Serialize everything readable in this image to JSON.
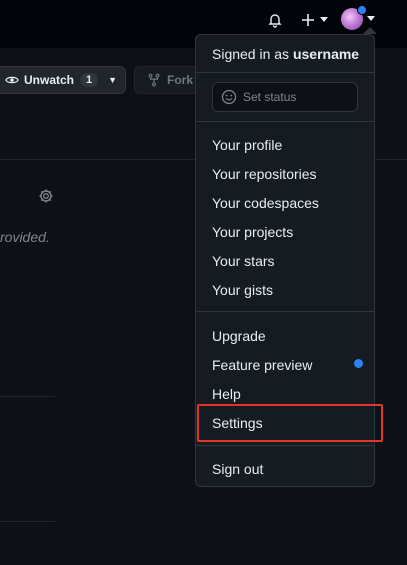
{
  "header": {
    "bell_icon": "bell-icon",
    "plus_icon": "plus-icon",
    "avatar": "user-avatar"
  },
  "repo_actions": {
    "unwatch_label": "Unwatch",
    "unwatch_count": "1",
    "fork_label": "Fork"
  },
  "main": {
    "description_fragment": "rovided."
  },
  "menu": {
    "signed_in_prefix": "Signed in as ",
    "username": "username",
    "set_status": "Set status",
    "items_group1": [
      "Your profile",
      "Your repositories",
      "Your codespaces",
      "Your projects",
      "Your stars",
      "Your gists"
    ],
    "items_group2": [
      "Upgrade",
      "Feature preview",
      "Help",
      "Settings"
    ],
    "sign_out": "Sign out"
  },
  "colors": {
    "accent_blue": "#2f81f7",
    "highlight_red": "#e5332a",
    "background": "#0d1117"
  }
}
